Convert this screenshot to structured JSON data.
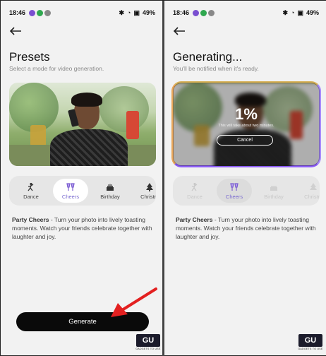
{
  "left": {
    "status": {
      "time": "18:46",
      "battery": "49%"
    },
    "title": "Presets",
    "subtitle": "Select a mode for video generation.",
    "modes": [
      {
        "label": "Dance",
        "icon": "dance-icon"
      },
      {
        "label": "Cheers",
        "icon": "cheers-icon",
        "active": true
      },
      {
        "label": "Birthday",
        "icon": "birthday-cake-icon"
      },
      {
        "label": "Christm",
        "icon": "christmas-tree-icon"
      }
    ],
    "description_bold": "Party Cheers",
    "description": " - Turn your photo into lively toasting moments. Watch your friends celebrate together with laughter and joy.",
    "generate_label": "Generate"
  },
  "right": {
    "status": {
      "time": "18:46",
      "battery": "49%"
    },
    "title": "Generating...",
    "subtitle": "You'll be notified when it's ready.",
    "progress_percent": "1%",
    "progress_note": "This will take about two minutes.",
    "cancel_label": "Cancel",
    "modes": [
      {
        "label": "Dance",
        "icon": "dance-icon"
      },
      {
        "label": "Cheers",
        "icon": "cheers-icon",
        "active": true
      },
      {
        "label": "Birthday",
        "icon": "birthday-cake-icon"
      },
      {
        "label": "Christm",
        "icon": "christmas-tree-icon"
      }
    ],
    "description_bold": "Party Cheers",
    "description": " - Turn your photo into lively toasting moments. Watch your friends celebrate together with laughter and joy."
  },
  "watermark": {
    "logo_text": "GU",
    "caption": "GADGETS TO USE"
  },
  "colors": {
    "accent": "#8b5cf6",
    "button": "#0a0a0a",
    "arrow": "#e32020"
  }
}
